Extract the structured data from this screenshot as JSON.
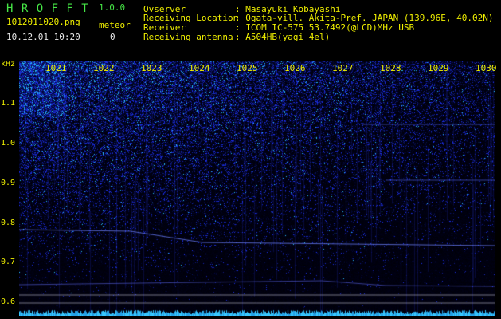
{
  "header": {
    "app_name": "H R O F F T",
    "version": "1.0.0",
    "filename": "1012011020.png",
    "meteor_label": "meteor",
    "datetime": "10.12.01 10:20",
    "meteor_count": "0",
    "info": [
      {
        "label": "Ovserver",
        "value": ": Masayuki Kobayashi"
      },
      {
        "label": "Receiving Location",
        "value": ": Ogata-vill. Akita-Pref. JAPAN (139.96E, 40.02N)"
      },
      {
        "label": "Receiver",
        "value": ": ICOM IC-575 53.7492(@LCD)MHz USB"
      },
      {
        "label": "Receiving antenna",
        "value": ": A504HB(yagi 4el)"
      }
    ]
  },
  "plot": {
    "y_unit": "kHz",
    "y_ticks": [
      "1.1",
      "1.0",
      "0.9",
      "0.8",
      "0.7",
      "0.6"
    ],
    "x_ticks": [
      "1021",
      "1022",
      "1023",
      "1024",
      "1025",
      "1026",
      "1027",
      "1028",
      "1029",
      "1030"
    ]
  },
  "colors": {
    "background": "#000000",
    "label_yellow": "#f0f000",
    "title_green": "#46e646",
    "waterfall_blue": "#1e2aff",
    "noise_cyan": "#38c8ff"
  }
}
